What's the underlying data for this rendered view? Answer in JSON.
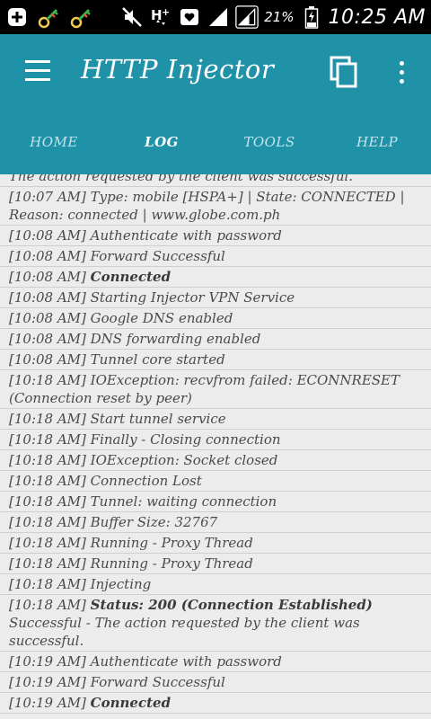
{
  "status_bar": {
    "battery_percent": "21%",
    "time": "10:25 AM",
    "icons": [
      "plus-notification-icon",
      "key-icon",
      "key-icon",
      "mute-icon",
      "hplus-data-icon",
      "heart-icon",
      "signal-icon",
      "signal-icon",
      "battery-icon"
    ]
  },
  "app_bar": {
    "title": "HTTP Injector",
    "color": "#1f92a8"
  },
  "tabs": [
    {
      "label": "HOME",
      "active": false
    },
    {
      "label": "LOG",
      "active": true
    },
    {
      "label": "TOOLS",
      "active": false
    },
    {
      "label": "HELP",
      "active": false
    }
  ],
  "log": [
    {
      "text": "The action requested by the client was successful."
    },
    {
      "text": "[10:07 AM] Type: mobile [HSPA+] | State: CONNECTED | Reason: connected | www.globe.com.ph"
    },
    {
      "text": "[10:08 AM] Authenticate with password"
    },
    {
      "text": "[10:08 AM] Forward Successful"
    },
    {
      "prefix": "[10:08 AM] ",
      "bold": "Connected",
      "suffix": ""
    },
    {
      "text": "[10:08 AM] Starting Injector VPN Service"
    },
    {
      "text": "[10:08 AM] Google DNS enabled"
    },
    {
      "text": "[10:08 AM] DNS forwarding enabled"
    },
    {
      "text": "[10:08 AM] Tunnel core started"
    },
    {
      "text": "[10:18 AM] IOException: recvfrom failed: ECONNRESET (Connection reset by peer)"
    },
    {
      "text": "[10:18 AM] Start tunnel service"
    },
    {
      "text": "[10:18 AM] Finally - Closing connection"
    },
    {
      "text": "[10:18 AM] IOException: Socket closed"
    },
    {
      "text": "[10:18 AM] Connection Lost"
    },
    {
      "text": "[10:18 AM] Tunnel: waiting connection"
    },
    {
      "text": "[10:18 AM] Buffer Size: 32767"
    },
    {
      "text": "[10:18 AM] Running - Proxy Thread"
    },
    {
      "text": "[10:18 AM] Running - Proxy Thread"
    },
    {
      "text": "[10:18 AM] Injecting"
    },
    {
      "prefix": "[10:18 AM] ",
      "bold": "Status: 200 (Connection Established)",
      "suffix": " Successful - The action requested by the client was successful."
    },
    {
      "text": "[10:19 AM] Authenticate with password"
    },
    {
      "text": "[10:19 AM] Forward Successful"
    },
    {
      "prefix": "[10:19 AM] ",
      "bold": "Connected",
      "suffix": ""
    }
  ]
}
